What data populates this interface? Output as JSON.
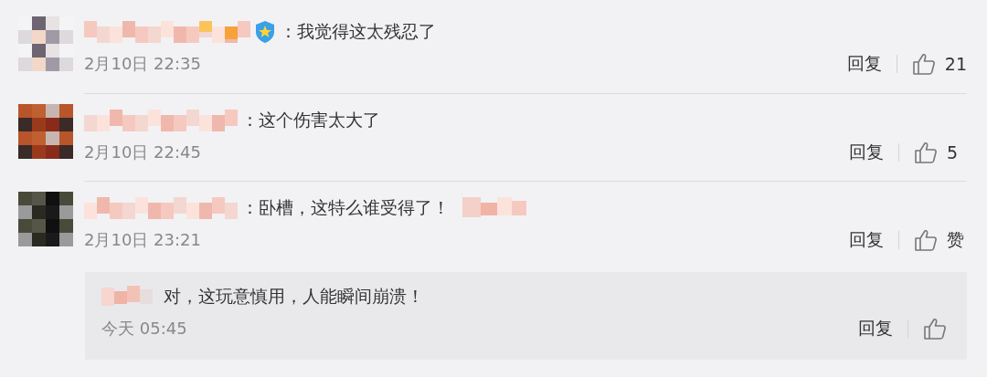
{
  "comments": [
    {
      "verified": true,
      "text": "：我觉得这太残忍了",
      "time": "2月10日 22:35",
      "reply": "回复",
      "like": "21",
      "tail_redacted": false
    },
    {
      "verified": false,
      "text": "：这个伤害太大了",
      "time": "2月10日 22:45",
      "reply": "回复",
      "like": "5",
      "tail_redacted": false
    },
    {
      "verified": false,
      "text": "：卧槽，这特么谁受得了！",
      "time": "2月10日 23:21",
      "reply": "回复",
      "like": "赞",
      "tail_redacted": true
    }
  ],
  "reply": {
    "text": "对，这玩意慎用，人能瞬间崩溃！",
    "time": "今天 05:45",
    "reply": "回复"
  }
}
